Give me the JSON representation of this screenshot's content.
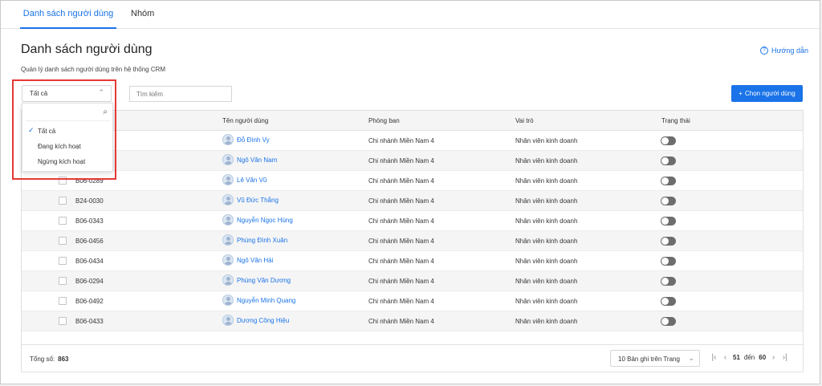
{
  "tabs": [
    {
      "label": "Danh sách người dùng",
      "active": true
    },
    {
      "label": "Nhóm",
      "active": false
    }
  ],
  "header": {
    "title": "Danh sách người dùng",
    "subtitle": "Quản lý danh sách người dùng trên hệ thống CRM",
    "help_label": "Hướng dẫn",
    "help_icon": "question-circle-icon"
  },
  "toolbar": {
    "status_value": "Tất cả",
    "search_placeholder": "Tìm kiếm",
    "choose_button_label": "Chọn người dùng",
    "choose_button_icon": "plus-icon"
  },
  "dropdown": {
    "search_icon": "search-icon",
    "options": [
      {
        "label": "Tất cả",
        "selected": true
      },
      {
        "label": "Đang kích hoạt",
        "selected": false
      },
      {
        "label": "Ngừng kích hoạt",
        "selected": false
      }
    ]
  },
  "table": {
    "columns": {
      "code": "Mã người dùng",
      "name": "Tên người dùng",
      "department": "Phòng ban",
      "role": "Vai trò",
      "status": "Trạng thái"
    },
    "code_header_visible_text": "ng",
    "rows": [
      {
        "code": "",
        "name": "Đỗ Đình Vy",
        "department": "Chi nhánh Miền Nam 4",
        "role": "Nhân viên kinh doanh",
        "active": false
      },
      {
        "code": "",
        "name": "Ngô Văn Nam",
        "department": "Chi nhánh Miền Nam 4",
        "role": "Nhân viên kinh doanh",
        "active": false
      },
      {
        "code": "B06-0289",
        "name": "Lê Văn Vũ",
        "department": "Chi nhánh Miền Nam 4",
        "role": "Nhân viên kinh doanh",
        "active": false
      },
      {
        "code": "B24-0030",
        "name": "Vũ Đức Thắng",
        "department": "Chi nhánh Miền Nam 4",
        "role": "Nhân viên kinh doanh",
        "active": false
      },
      {
        "code": "B06-0343",
        "name": "Nguyễn Ngọc Hùng",
        "department": "Chi nhánh Miền Nam 4",
        "role": "Nhân viên kinh doanh",
        "active": false
      },
      {
        "code": "B06-0456",
        "name": "Phùng Đình Xuân",
        "department": "Chi nhánh Miền Nam 4",
        "role": "Nhân viên kinh doanh",
        "active": false
      },
      {
        "code": "B06-0434",
        "name": "Ngô Văn Hải",
        "department": "Chi nhánh Miền Nam 4",
        "role": "Nhân viên kinh doanh",
        "active": false
      },
      {
        "code": "B06-0294",
        "name": "Phùng Văn Dương",
        "department": "Chi nhánh Miền Nam 4",
        "role": "Nhân viên kinh doanh",
        "active": false
      },
      {
        "code": "B06-0492",
        "name": "Nguyễn Minh Quang",
        "department": "Chi nhánh Miền Nam 4",
        "role": "Nhân viên kinh doanh",
        "active": false
      },
      {
        "code": "B06-0433",
        "name": "Dương Công Hiệu",
        "department": "Chi nhánh Miền Nam 4",
        "role": "Nhân viên kinh doanh",
        "active": false
      }
    ]
  },
  "footer": {
    "total_label": "Tổng số:",
    "total_value": "863",
    "page_size_label": "10 Bản ghi trên Trang",
    "range_from": "51",
    "range_sep": "đến",
    "range_to": "60"
  },
  "colors": {
    "accent": "#1a73e8",
    "highlight": "#e53935",
    "toggle_off": "#6d6d6d"
  }
}
